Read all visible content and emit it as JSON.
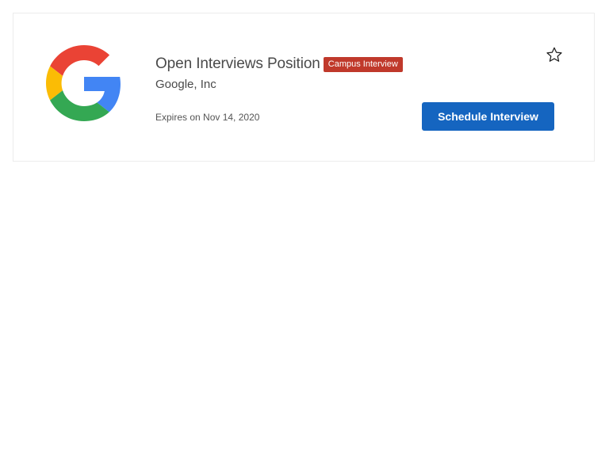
{
  "job": {
    "title": "Open Interviews Position",
    "badge": "Campus Interview",
    "company": "Google, Inc",
    "expires": "Expires on Nov 14, 2020",
    "schedule_label": "Schedule Interview",
    "logo_icon": "google-logo-icon",
    "favorite_icon": "star-outline-icon"
  },
  "colors": {
    "badge_bg": "#c0392b",
    "button_bg": "#1565c0",
    "google_red": "#EA4335",
    "google_yellow": "#FBBC05",
    "google_green": "#34A853",
    "google_blue": "#4285F4"
  }
}
